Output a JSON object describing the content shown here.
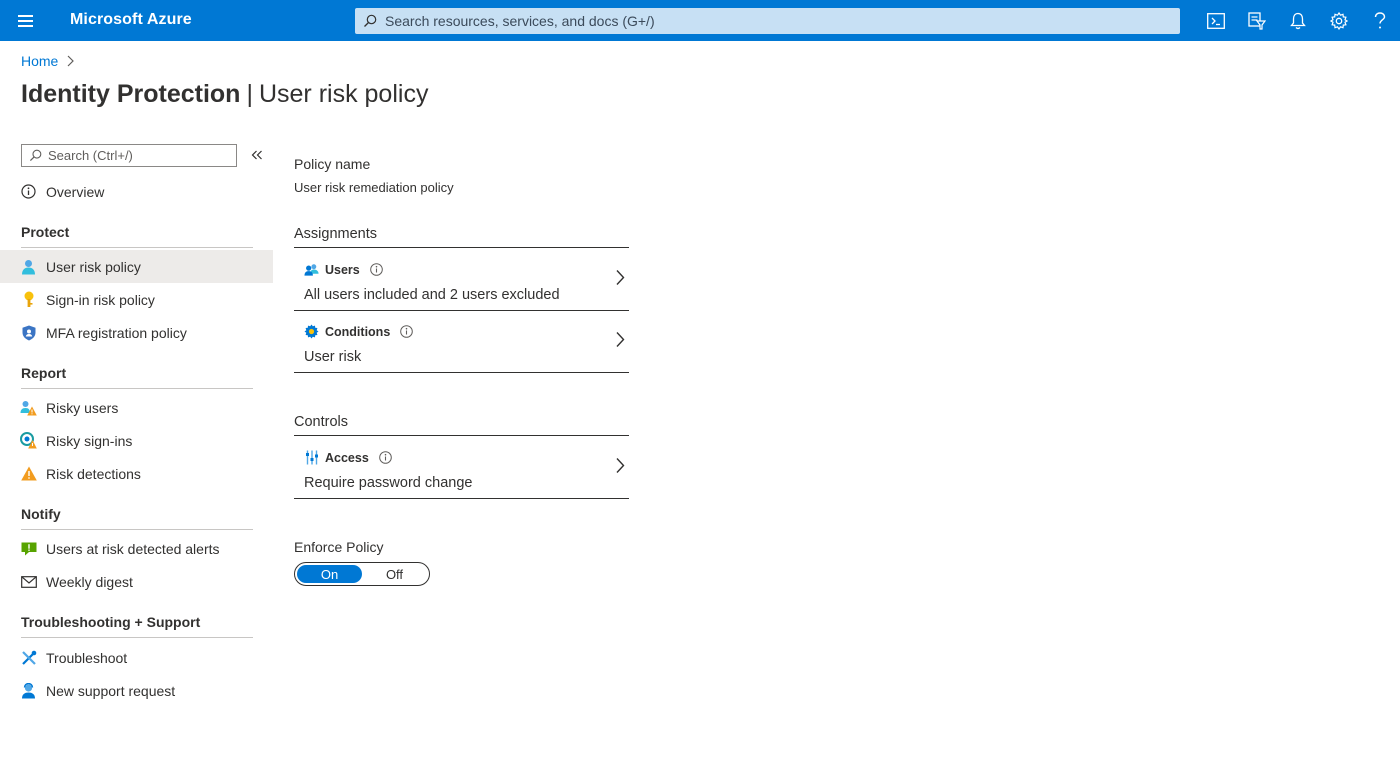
{
  "topbar": {
    "brand": "Microsoft Azure",
    "search_placeholder": "Search resources, services, and docs (G+/)",
    "icons": [
      "cloud-shell-icon",
      "directory-filter-icon",
      "notifications-icon",
      "settings-icon",
      "help-icon"
    ],
    "accent": "#0078d4"
  },
  "breadcrumb": {
    "home": "Home"
  },
  "page": {
    "title_main": "Identity Protection",
    "title_separator": "|",
    "title_sub": "User risk policy"
  },
  "nav": {
    "search_placeholder": "Search (Ctrl+/)",
    "overview": "Overview",
    "protect_header": "Protect",
    "protect_items": [
      "User risk policy",
      "Sign-in risk policy",
      "MFA registration policy"
    ],
    "report_header": "Report",
    "report_items": [
      "Risky users",
      "Risky sign-ins",
      "Risk detections"
    ],
    "notify_header": "Notify",
    "notify_items": [
      "Users at risk detected alerts",
      "Weekly digest"
    ],
    "support_header": "Troubleshooting + Support",
    "support_items": [
      "Troubleshoot",
      "New support request"
    ]
  },
  "content": {
    "policy_name_label": "Policy name",
    "policy_name_value": "User risk remediation policy",
    "assignments_header": "Assignments",
    "users_title": "Users",
    "users_desc": "All users included and 2 users excluded",
    "conditions_title": "Conditions",
    "conditions_desc": "User risk",
    "controls_header": "Controls",
    "access_title": "Access",
    "access_desc": "Require password change",
    "enforce_label": "Enforce Policy",
    "toggle_on": "On",
    "toggle_off": "Off",
    "enforce_selected": "On"
  }
}
